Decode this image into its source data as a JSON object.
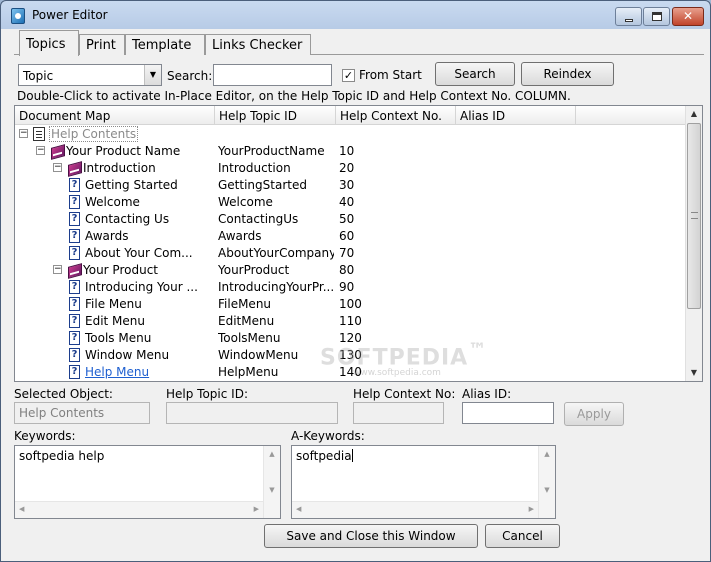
{
  "window": {
    "title": "Power Editor"
  },
  "tabs": [
    {
      "label": "Topics",
      "active": true
    },
    {
      "label": "Print",
      "active": false
    },
    {
      "label": "Template",
      "active": false
    },
    {
      "label": "Links Checker",
      "active": false
    }
  ],
  "search": {
    "type_value": "Topic",
    "label": "Search:",
    "value": "",
    "from_start_label": "From Start",
    "from_start_checked": true,
    "search_button": "Search",
    "reindex_button": "Reindex"
  },
  "hint": "Double-Click to activate In-Place Editor, on the Help Topic ID and Help Context No. COLUMN.",
  "grid": {
    "columns": [
      "Document Map",
      "Help Topic ID",
      "Help Context No.",
      "Alias ID"
    ],
    "rows": [
      {
        "name": "Help Contents",
        "topic_id": "",
        "context": "",
        "icon": "document-icon",
        "level": 0,
        "expander": "−"
      },
      {
        "name": "Your Product Name",
        "topic_id": "YourProductName",
        "context": "10",
        "icon": "book-icon",
        "level": 1,
        "expander": "−"
      },
      {
        "name": "Introduction",
        "topic_id": "Introduction",
        "context": "20",
        "icon": "book-icon",
        "level": 2,
        "expander": "−"
      },
      {
        "name": "Getting Started",
        "topic_id": "GettingStarted",
        "context": "30",
        "icon": "help-topic-icon",
        "level": 3,
        "expander": ""
      },
      {
        "name": "Welcome",
        "topic_id": "Welcome",
        "context": "40",
        "icon": "help-topic-icon",
        "level": 3,
        "expander": ""
      },
      {
        "name": "Contacting Us",
        "topic_id": "ContactingUs",
        "context": "50",
        "icon": "help-topic-icon",
        "level": 3,
        "expander": ""
      },
      {
        "name": "Awards",
        "topic_id": "Awards",
        "context": "60",
        "icon": "help-topic-icon",
        "level": 3,
        "expander": ""
      },
      {
        "name": "About Your Com...",
        "topic_id": "AboutYourCompany",
        "context": "70",
        "icon": "help-topic-icon",
        "level": 3,
        "expander": ""
      },
      {
        "name": "Your Product",
        "topic_id": "YourProduct",
        "context": "80",
        "icon": "book-icon",
        "level": 2,
        "expander": "−"
      },
      {
        "name": "Introducing Your ...",
        "topic_id": "IntroducingYourPr...",
        "context": "90",
        "icon": "help-topic-icon",
        "level": 3,
        "expander": ""
      },
      {
        "name": "File Menu",
        "topic_id": "FileMenu",
        "context": "100",
        "icon": "help-topic-icon",
        "level": 3,
        "expander": ""
      },
      {
        "name": "Edit Menu",
        "topic_id": "EditMenu",
        "context": "110",
        "icon": "help-topic-icon",
        "level": 3,
        "expander": ""
      },
      {
        "name": "Tools Menu",
        "topic_id": "ToolsMenu",
        "context": "120",
        "icon": "help-topic-icon",
        "level": 3,
        "expander": ""
      },
      {
        "name": "Window Menu",
        "topic_id": "WindowMenu",
        "context": "130",
        "icon": "help-topic-icon",
        "level": 3,
        "expander": ""
      },
      {
        "name": "Help Menu",
        "topic_id": "HelpMenu",
        "context": "140",
        "icon": "help-topic-icon",
        "level": 3,
        "expander": "",
        "link": true
      }
    ]
  },
  "details": {
    "selected_object_label": "Selected Object:",
    "selected_object_value": "Help Contents",
    "help_topic_id_label": "Help Topic ID:",
    "help_topic_id_value": "",
    "help_context_no_label": "Help Context No:",
    "help_context_no_value": "",
    "alias_id_label": "Alias ID:",
    "alias_id_value": "",
    "apply_button": "Apply"
  },
  "keywords": {
    "label": "Keywords:",
    "value": "softpedia help"
  },
  "a_keywords": {
    "label": "A-Keywords:",
    "value": "softpedia"
  },
  "footer": {
    "save_close_button": "Save and Close  this Window",
    "cancel_button": "Cancel"
  },
  "watermark": {
    "text": "SOFTPEDIA",
    "tm": "™",
    "sub": "www.softpedia.com"
  },
  "colors": {
    "link": "#1e5fd0",
    "titlebar": "#b7cbe6",
    "close_button": "#c1442b"
  }
}
